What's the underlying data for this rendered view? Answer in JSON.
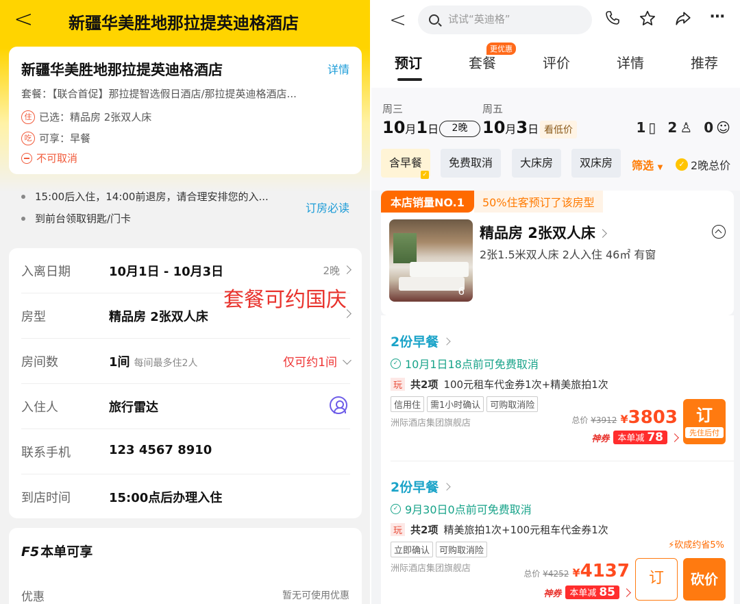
{
  "left": {
    "header": {
      "back": "<",
      "title": "新疆华美胜地那拉提英迪格酒店"
    },
    "hotel_card": {
      "name": "新疆华美胜地那拉提英迪格酒店",
      "detail_link": "详情",
      "package": "套餐：【联合首促】那拉提智选假日酒店/那拉提英迪格酒店...",
      "stay_badge": "住",
      "selected": "已选：精品房 2张双人床",
      "eat_badge": "吃",
      "enjoy": "可享：早餐",
      "no_cancel": "不可取消"
    },
    "tips": {
      "items": [
        "15:00后入住，14:00前退房，请合理安排您的入...",
        "到前台领取钥匙/门卡"
      ],
      "must_read": "订房必读"
    },
    "form": {
      "dates": {
        "label": "入离日期",
        "value": "10月1日 - 10月3日",
        "nights": "2晚"
      },
      "room_type": {
        "label": "房型",
        "value": "精品房 2张双人床"
      },
      "rooms": {
        "label": "房间数",
        "value": "1间",
        "sub": "每间最多住2人",
        "limit": "仅可约1间"
      },
      "guest": {
        "label": "入住人",
        "value": "旅行雷达"
      },
      "phone": {
        "label": "联系手机",
        "value": "123 4567 8910"
      },
      "arrival": {
        "label": "到店时间",
        "value": "15:00点后办理入住"
      }
    },
    "overlay_text": "套餐可约国庆",
    "benefits": {
      "f5": "F5",
      "title": "本单可享",
      "discount_label": "优惠",
      "discount_value": "暂无可使用优惠"
    }
  },
  "right": {
    "back": "<",
    "search_placeholder": "试试“英迪格”",
    "tabs": [
      {
        "label": "预订"
      },
      {
        "label": "套餐",
        "badge": "更优惠"
      },
      {
        "label": "评价"
      },
      {
        "label": "详情"
      },
      {
        "label": "推荐"
      }
    ],
    "dates": {
      "checkin_weekday": "周三",
      "checkin_num": "10",
      "checkin_month_label": "月",
      "checkin_day": "1",
      "checkin_day_label": "日",
      "nights": "2晚",
      "checkout_weekday": "周五",
      "checkout_num": "10",
      "checkout_month_label": "月",
      "checkout_day": "3",
      "checkout_day_label": "日",
      "low_price": "看低价",
      "rooms_count": "1",
      "adults_count": "2",
      "children_count": "0"
    },
    "filters": [
      "含早餐",
      "免费取消",
      "大床房",
      "双床房"
    ],
    "filter_button": "筛选",
    "total_toggle": "2晚总价",
    "room": {
      "sales_badge": "本店销量NO.1",
      "booked_pct": "50%住客预订了该房型",
      "name": "精品房 2张双人床",
      "info": "2张1.5米双人床  2人入住  46㎡  有窗",
      "photo_count": "6"
    },
    "offers": [
      {
        "breakfast": "2份早餐",
        "cancel": "10月1日18点前可免费取消",
        "play_tag": "玩",
        "play_count": "共2项",
        "play_desc": "100元租车代金券1次+精美旅拍1次",
        "chips": [
          "信用住",
          "需1小时确认",
          "可购取消险"
        ],
        "brand": "洲际酒店集团旗舰店",
        "orig_label": "总价",
        "orig_price": "¥3912",
        "currency": "¥",
        "price": "3803",
        "coupon_label": "神券",
        "coupon_text": "本单减",
        "coupon_amount": "78",
        "book_label": "订",
        "book_sub": "先住后付"
      },
      {
        "breakfast": "2份早餐",
        "cancel": "9月30日0点前可免费取消",
        "play_tag": "玩",
        "play_count": "共2项",
        "play_desc": "精美旅拍1次+100元租车代金券1次",
        "chips": [
          "立即确认",
          "可购取消险"
        ],
        "brand": "洲际酒店集团旗舰店",
        "save_text": "砍成约省5%",
        "orig_label": "总价",
        "orig_price": "¥4252",
        "currency": "¥",
        "price": "4137",
        "coupon_label": "神券",
        "coupon_text": "本单减",
        "coupon_amount": "85",
        "book_label": "订",
        "bargain_label": "砍价"
      }
    ]
  }
}
